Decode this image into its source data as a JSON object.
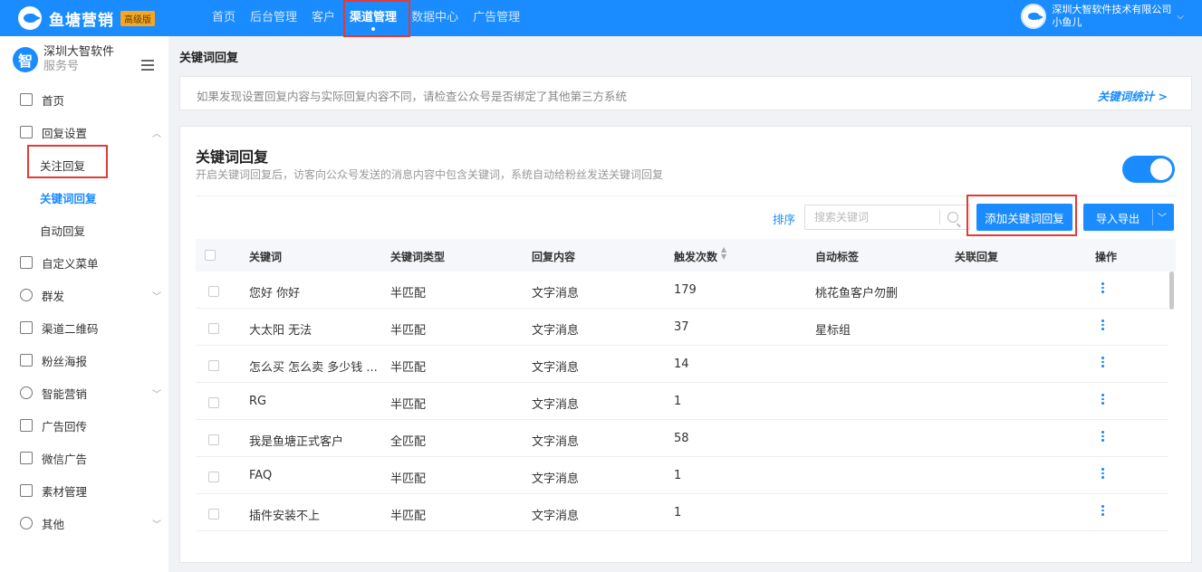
{
  "app": {
    "name": "鱼塘营销",
    "badge": "高级版"
  },
  "topnav": [
    {
      "label": "首页",
      "active": false
    },
    {
      "label": "后台管理",
      "active": false
    },
    {
      "label": "客户",
      "active": false
    },
    {
      "label": "渠道管理",
      "active": true
    },
    {
      "label": "数据中心",
      "active": false
    },
    {
      "label": "广告管理",
      "active": false
    }
  ],
  "user": {
    "company": "深圳大智软件技术有限公司",
    "name": "小鱼儿"
  },
  "account": {
    "logo_char": "智",
    "name": "深圳大智软件",
    "type": "服务号"
  },
  "sidebar": {
    "items": [
      {
        "label": "首页",
        "icon": "home-icon"
      },
      {
        "label": "回复设置",
        "icon": "reply-icon",
        "expanded": true
      },
      {
        "label": "关注回复",
        "sub": true
      },
      {
        "label": "关键词回复",
        "sub": true,
        "active": true
      },
      {
        "label": "自动回复",
        "sub": true
      },
      {
        "label": "自定义菜单",
        "icon": "menu-grid-icon"
      },
      {
        "label": "群发",
        "icon": "users-icon"
      },
      {
        "label": "渠道二维码",
        "icon": "qrcode-icon"
      },
      {
        "label": "粉丝海报",
        "icon": "poster-icon"
      },
      {
        "label": "智能营销",
        "icon": "bulb-icon"
      },
      {
        "label": "广告回传",
        "icon": "ad-icon"
      },
      {
        "label": "微信广告",
        "icon": "wechat-ad-icon"
      },
      {
        "label": "素材管理",
        "icon": "material-icon"
      },
      {
        "label": "其他",
        "icon": "settings-icon"
      }
    ]
  },
  "page": {
    "title": "关键词回复",
    "notice": "如果发现设置回复内容与实际回复内容不同，请检查公众号是否绑定了其他第三方系统",
    "notice_link": "关键词统计 >"
  },
  "card": {
    "title": "关键词回复",
    "desc": "开启关键词回复后，访客向公众号发送的消息内容中包含关键词，系统自动给粉丝发送关键词回复",
    "toggle_on": true,
    "sort_label": "排序",
    "search_placeholder": "搜索关键词",
    "add_button": "添加关键词回复",
    "io_button": "导入导出"
  },
  "table": {
    "headers": [
      "关键词",
      "关键词类型",
      "回复内容",
      "触发次数",
      "自动标签",
      "关联回复",
      "操作"
    ],
    "rows": [
      {
        "keyword": "您好 你好",
        "type": "半匹配",
        "content": "文字消息",
        "count": "179",
        "tag": "桃花鱼客户勿删",
        "linked": ""
      },
      {
        "keyword": "大太阳 无法",
        "type": "半匹配",
        "content": "文字消息",
        "count": "37",
        "tag": "星标组",
        "linked": ""
      },
      {
        "keyword": "怎么买 怎么卖 多少钱 ...",
        "type": "半匹配",
        "content": "文字消息",
        "count": "14",
        "tag": "",
        "linked": ""
      },
      {
        "keyword": "RG",
        "type": "半匹配",
        "content": "文字消息",
        "count": "1",
        "tag": "",
        "linked": ""
      },
      {
        "keyword": "我是鱼塘正式客户",
        "type": "全匹配",
        "content": "文字消息",
        "count": "58",
        "tag": "",
        "linked": ""
      },
      {
        "keyword": "FAQ",
        "type": "半匹配",
        "content": "文字消息",
        "count": "1",
        "tag": "",
        "linked": ""
      },
      {
        "keyword": "插件安装不上",
        "type": "半匹配",
        "content": "文字消息",
        "count": "1",
        "tag": "",
        "linked": ""
      }
    ]
  },
  "colors": {
    "primary": "#1a8cff",
    "highlight": "#e53935"
  }
}
